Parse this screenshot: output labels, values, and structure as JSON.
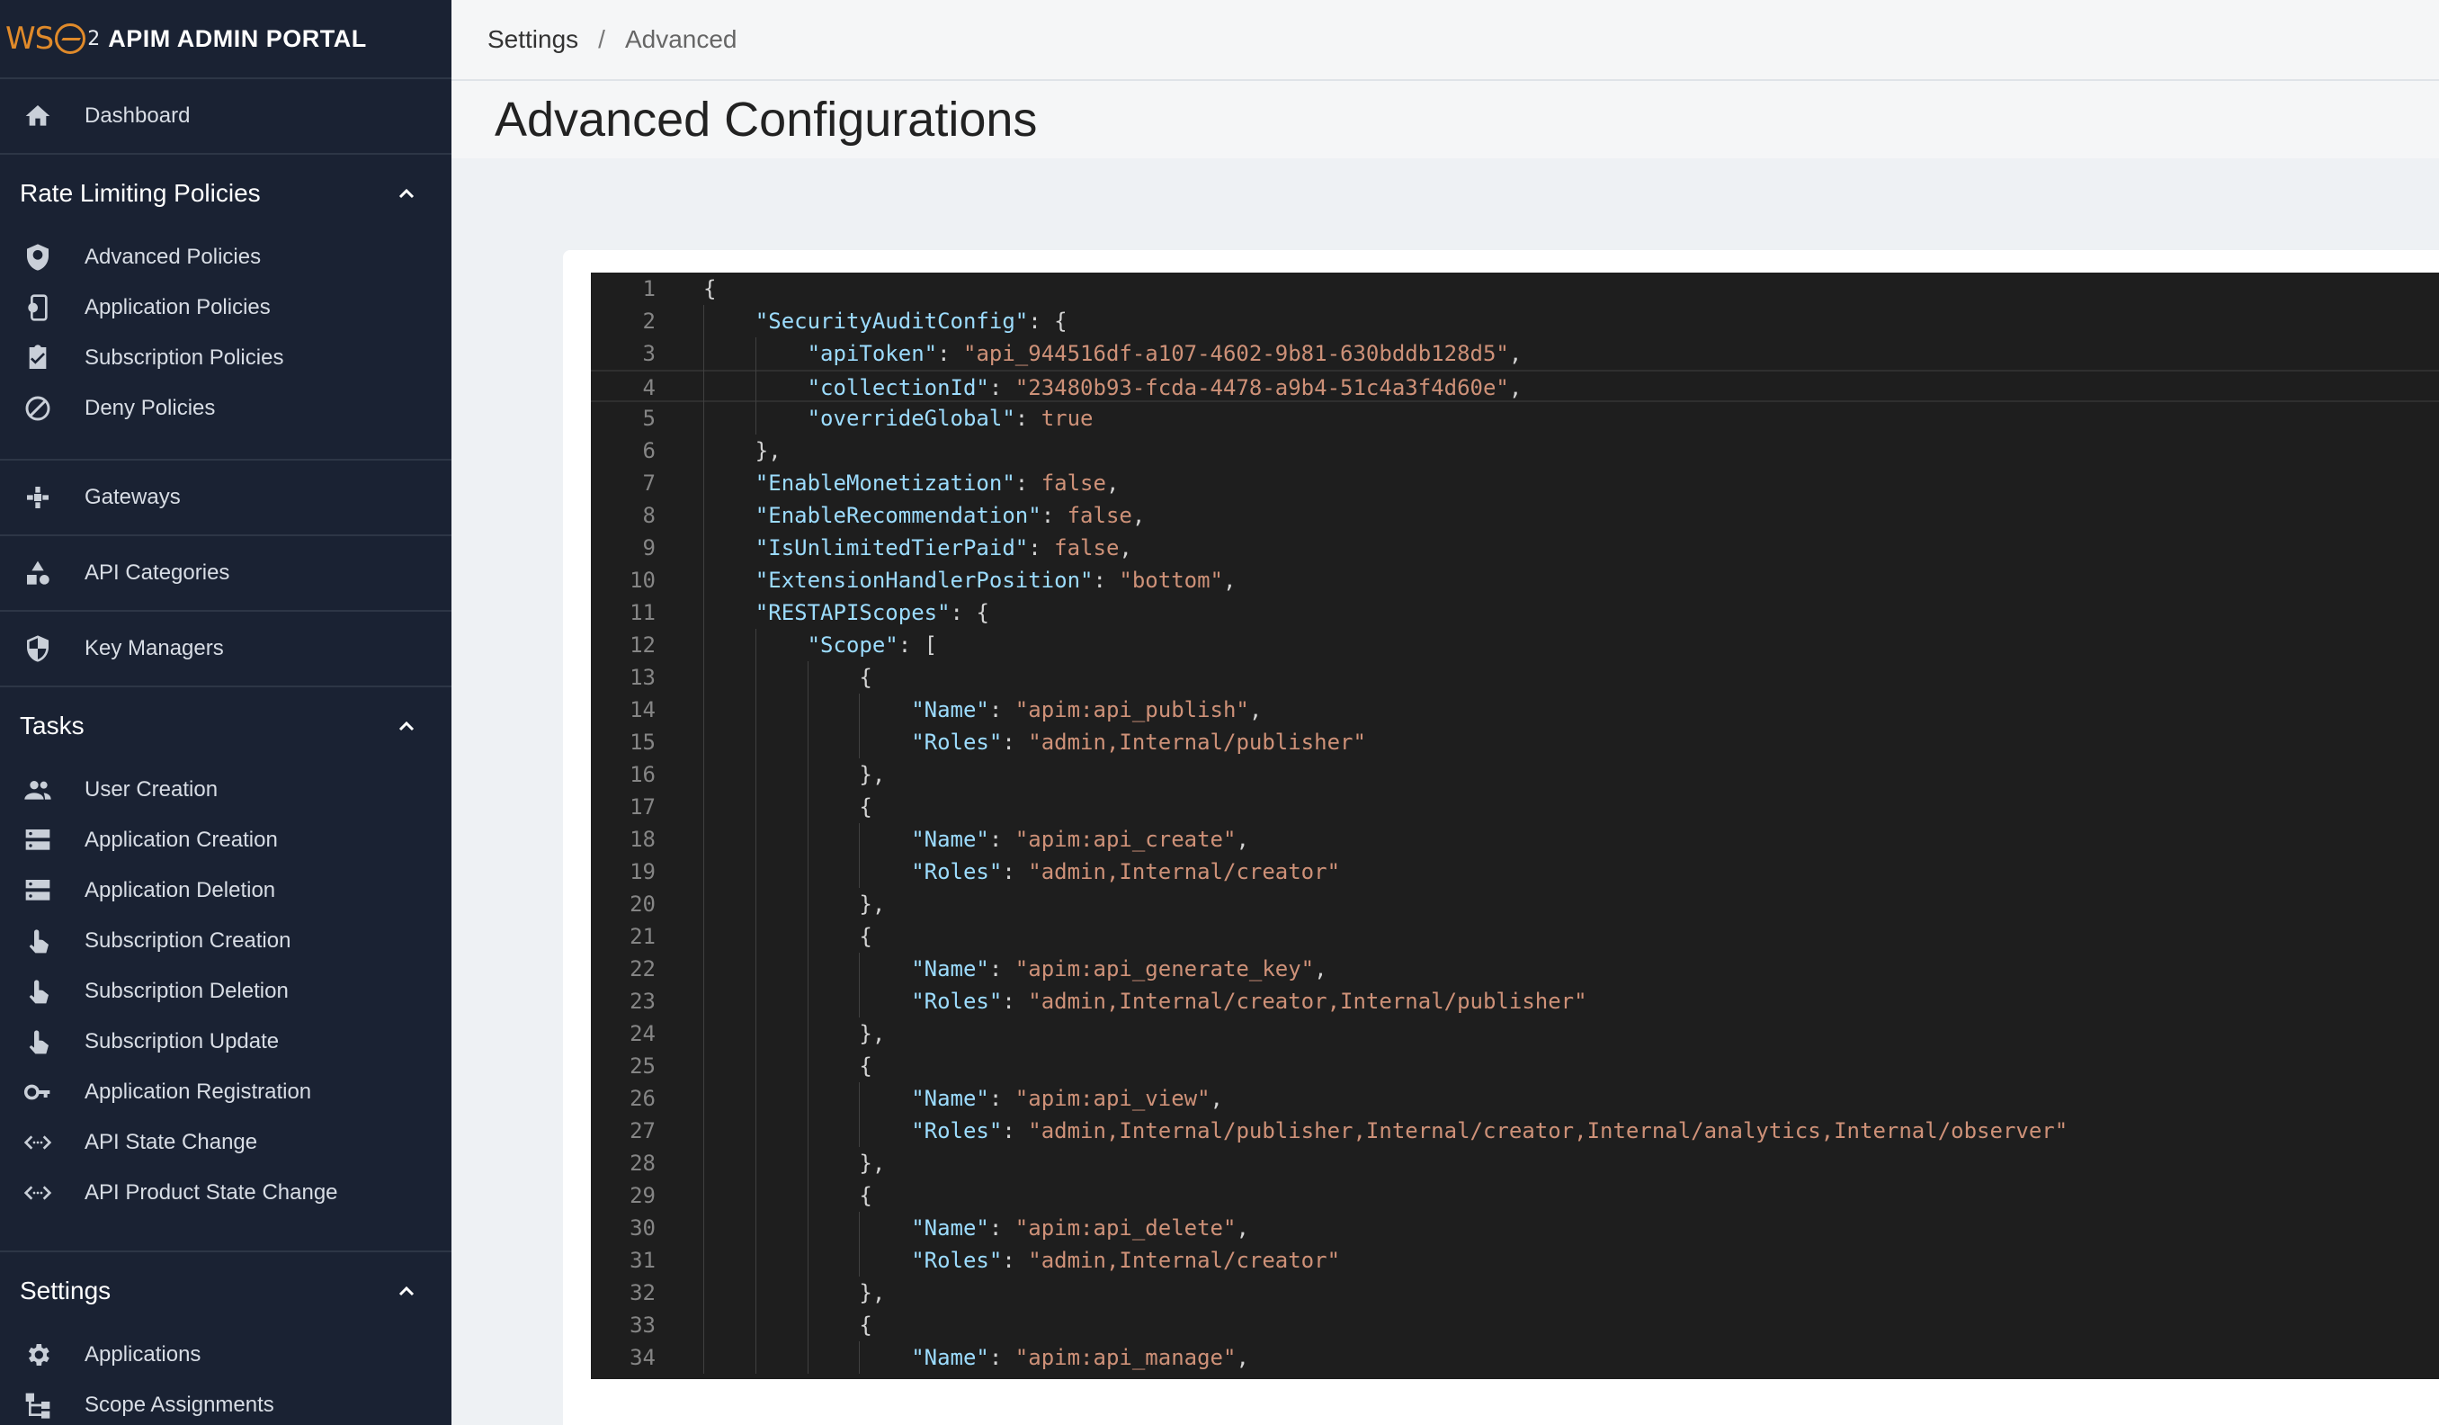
{
  "brand": {
    "logo_text": "WSO",
    "logo_sub": "2",
    "title": "APIM ADMIN PORTAL"
  },
  "sidebar": {
    "dashboard": {
      "label": "Dashboard",
      "icon": "home-icon"
    },
    "rate_limiting": {
      "title": "Rate Limiting Policies",
      "items": [
        {
          "label": "Advanced Policies",
          "icon": "policy-shield-icon"
        },
        {
          "label": "Application Policies",
          "icon": "app-settings-icon"
        },
        {
          "label": "Subscription Policies",
          "icon": "clipboard-check-icon"
        },
        {
          "label": "Deny Policies",
          "icon": "block-icon"
        }
      ]
    },
    "gateways": {
      "label": "Gateways",
      "icon": "gateway-icon"
    },
    "api_categories": {
      "label": "API Categories",
      "icon": "category-icon"
    },
    "key_managers": {
      "label": "Key Managers",
      "icon": "shield-key-icon"
    },
    "tasks": {
      "title": "Tasks",
      "items": [
        {
          "label": "User Creation",
          "icon": "people-icon"
        },
        {
          "label": "Application Creation",
          "icon": "storage-icon"
        },
        {
          "label": "Application Deletion",
          "icon": "storage-icon"
        },
        {
          "label": "Subscription Creation",
          "icon": "touch-icon"
        },
        {
          "label": "Subscription Deletion",
          "icon": "touch-icon"
        },
        {
          "label": "Subscription Update",
          "icon": "touch-icon"
        },
        {
          "label": "Application Registration",
          "icon": "key-icon"
        },
        {
          "label": "API State Change",
          "icon": "code-arrows-icon"
        },
        {
          "label": "API Product State Change",
          "icon": "code-arrows-icon"
        }
      ]
    },
    "settings": {
      "title": "Settings",
      "items": [
        {
          "label": "Applications",
          "icon": "gear-icon"
        },
        {
          "label": "Scope Assignments",
          "icon": "tree-icon"
        }
      ]
    }
  },
  "breadcrumb": {
    "parent": "Settings",
    "separator": "/",
    "current": "Advanced"
  },
  "page_title": "Advanced Configurations",
  "editor": {
    "lines": [
      "{",
      "    \"SecurityAuditConfig\": {",
      "        \"apiToken\": \"api_944516df-a107-4602-9b81-630bddb128d5\",",
      "        \"collectionId\": \"23480b93-fcda-4478-a9b4-51c4a3f4d60e\",",
      "        \"overrideGlobal\": true",
      "    },",
      "    \"EnableMonetization\": false,",
      "    \"EnableRecommendation\": false,",
      "    \"IsUnlimitedTierPaid\": false,",
      "    \"ExtensionHandlerPosition\": \"bottom\",",
      "    \"RESTAPIScopes\": {",
      "        \"Scope\": [",
      "            {",
      "                \"Name\": \"apim:api_publish\",",
      "                \"Roles\": \"admin,Internal/publisher\"",
      "            },",
      "            {",
      "                \"Name\": \"apim:api_create\",",
      "                \"Roles\": \"admin,Internal/creator\"",
      "            },",
      "            {",
      "                \"Name\": \"apim:api_generate_key\",",
      "                \"Roles\": \"admin,Internal/creator,Internal/publisher\"",
      "            },",
      "            {",
      "                \"Name\": \"apim:api_view\",",
      "                \"Roles\": \"admin,Internal/publisher,Internal/creator,Internal/analytics,Internal/observer\"",
      "            },",
      "            {",
      "                \"Name\": \"apim:api_delete\",",
      "                \"Roles\": \"admin,Internal/creator\"",
      "            },",
      "            {",
      "                \"Name\": \"apim:api_manage\","
    ],
    "active_line": 4
  },
  "colors": {
    "sidebar_bg": "#1a2233",
    "editor_bg": "#1e1e1e",
    "key": "#9cdcfe",
    "string": "#ce9178",
    "brand_orange": "#e08a2a"
  }
}
